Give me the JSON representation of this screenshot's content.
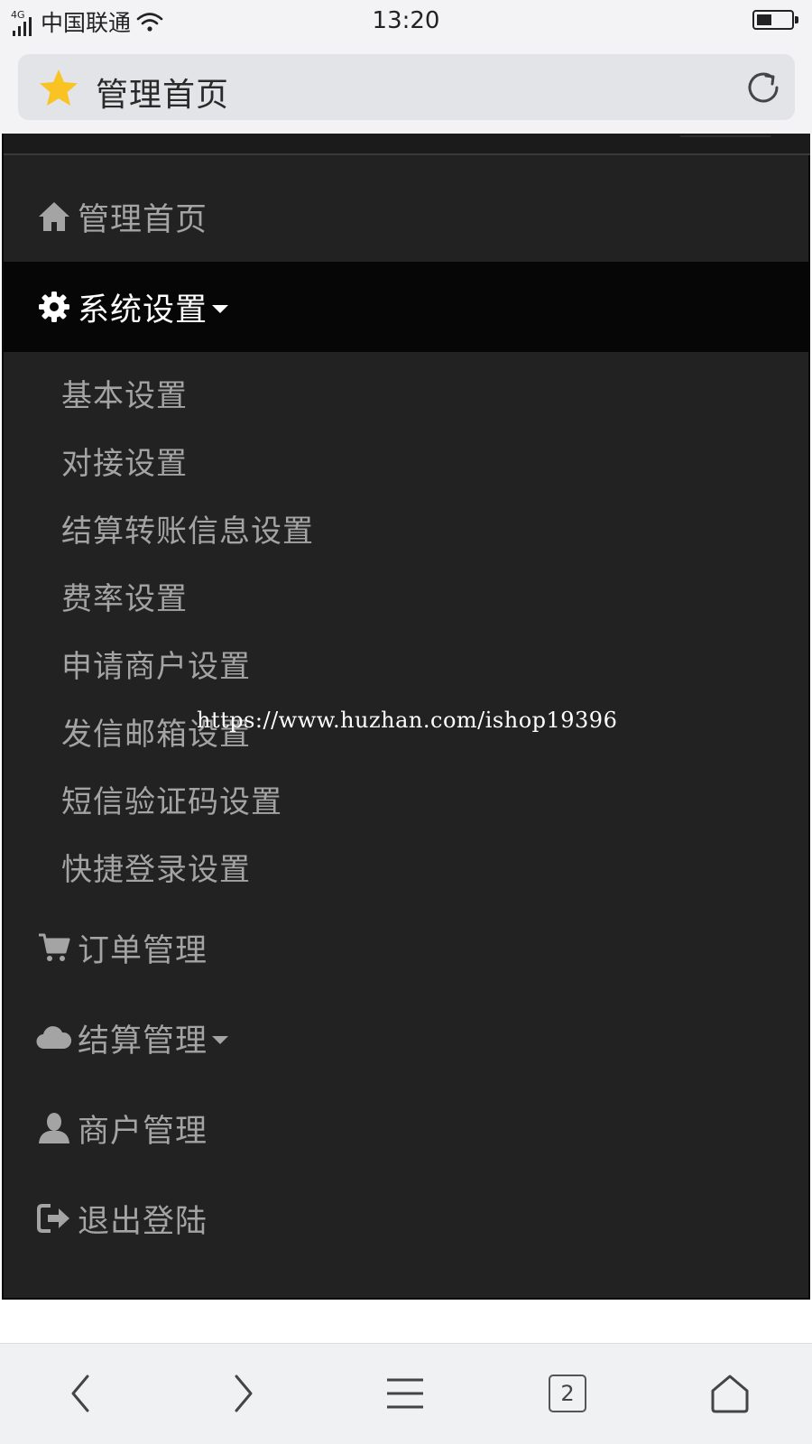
{
  "status_bar": {
    "network_type": "4G",
    "carrier": "中国联通",
    "time": "13:20",
    "battery_level": 0.45
  },
  "address_bar": {
    "title": "管理首页",
    "star_color": "#f8c323"
  },
  "menu": {
    "items": [
      {
        "label": "管理首页",
        "icon": "home-icon"
      },
      {
        "label": "系统设置",
        "icon": "gear-icon",
        "active": true,
        "has_caret": true
      },
      {
        "label": "订单管理",
        "icon": "cart-icon"
      },
      {
        "label": "结算管理",
        "icon": "cloud-icon",
        "has_caret": true
      },
      {
        "label": "商户管理",
        "icon": "user-icon"
      },
      {
        "label": "退出登陆",
        "icon": "logout-icon"
      }
    ],
    "submenu": [
      "基本设置",
      "对接设置",
      "结算转账信息设置",
      "费率设置",
      "申请商户设置",
      "发信邮箱设置",
      "短信验证码设置",
      "快捷登录设置"
    ]
  },
  "watermark": "https://www.huzhan.com/ishop19396",
  "toolbar": {
    "tabs_count": "2"
  },
  "colors": {
    "menu_bg": "#222222",
    "active_bg": "#060606",
    "menu_text": "#a4a4a4",
    "active_text": "#ffffff"
  }
}
